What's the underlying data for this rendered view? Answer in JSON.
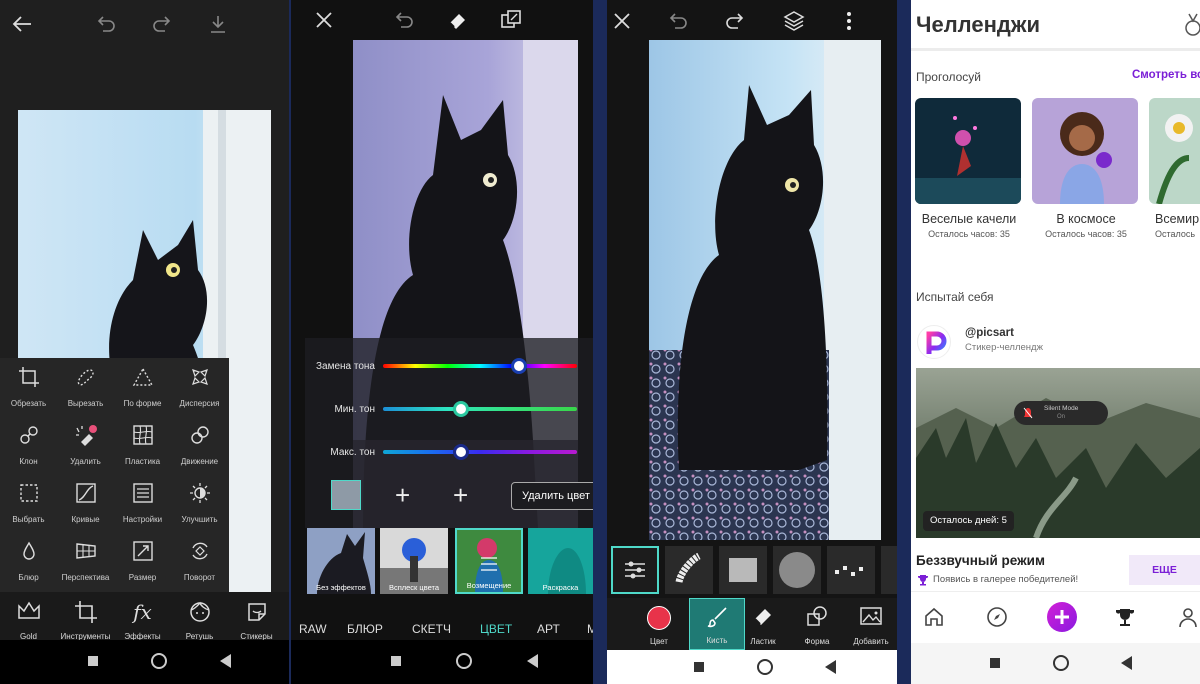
{
  "screen1": {
    "tools": [
      {
        "label": "Обрезать",
        "icon": "crop-icon"
      },
      {
        "label": "Вырезать",
        "icon": "cutout-icon"
      },
      {
        "label": "По форме",
        "icon": "shape-crop-icon"
      },
      {
        "label": "Дисперсия",
        "icon": "dispersion-icon"
      },
      {
        "label": "Клон",
        "icon": "clone-icon"
      },
      {
        "label": "Удалить",
        "icon": "remove-icon"
      },
      {
        "label": "Пластика",
        "icon": "stretch-icon"
      },
      {
        "label": "Движение",
        "icon": "motion-icon"
      },
      {
        "label": "Выбрать",
        "icon": "select-icon"
      },
      {
        "label": "Кривые",
        "icon": "curves-icon"
      },
      {
        "label": "Настройки",
        "icon": "adjust-icon"
      },
      {
        "label": "Улучшить",
        "icon": "enhance-icon"
      },
      {
        "label": "Блюр",
        "icon": "blur-drop-icon"
      },
      {
        "label": "Перспектива",
        "icon": "perspective-icon"
      },
      {
        "label": "Размер",
        "icon": "resize-icon"
      },
      {
        "label": "Поворот",
        "icon": "rotate-icon"
      }
    ],
    "bottom": [
      {
        "label": "Gold",
        "icon": "crown-icon"
      },
      {
        "label": "Инструменты",
        "icon": "crop-icon"
      },
      {
        "label": "Эффекты",
        "icon": "fx-icon",
        "glyph": "fx"
      },
      {
        "label": "Ретушь",
        "icon": "face-icon"
      },
      {
        "label": "Стикеры",
        "icon": "sticker-icon"
      }
    ]
  },
  "screen2": {
    "sliders": [
      {
        "label": "Замена тона",
        "value": 0.7
      },
      {
        "label": "Мин. тон",
        "value": 0.4
      },
      {
        "label": "Макс. тон",
        "value": 0.4
      }
    ],
    "plus1": "+",
    "plus2": "+",
    "remove_color": "Удалить цвет",
    "swatch_color": "#8e9aa6",
    "thumbs": [
      {
        "label": "Без эффектов"
      },
      {
        "label": "Всплеск цвета"
      },
      {
        "label": "Возмещение"
      },
      {
        "label": "Раскраска"
      }
    ],
    "categories": [
      "RAW",
      "БЛЮР",
      "СКЕТЧ",
      "ЦВЕТ",
      "АРТ",
      "M"
    ],
    "active_category": "ЦВЕТ",
    "accent": "#4fd9c9"
  },
  "screen3": {
    "tools": [
      {
        "label": "Цвет",
        "icon": "color-dot-icon"
      },
      {
        "label": "Кисть",
        "icon": "brush-icon"
      },
      {
        "label": "Ластик",
        "icon": "eraser-icon"
      },
      {
        "label": "Форма",
        "icon": "shape-icon"
      },
      {
        "label": "Добавить",
        "icon": "add-photo-icon"
      }
    ],
    "brush_color": "#e8334a"
  },
  "screen4": {
    "title": "Челленджи",
    "vote": "Проголосуй",
    "see_all": "Смотреть все",
    "cards": [
      {
        "title": "Веселые качели",
        "sub": "Осталось часов: 35"
      },
      {
        "title": "В космосе",
        "sub": "Осталось часов: 35"
      },
      {
        "title": "Всемирн",
        "sub": "Осталось"
      }
    ],
    "try_yourself": "Испытай себя",
    "author": "@picsart",
    "author_sub": "Стикер-челлендж",
    "silent_mode": "Silent Mode",
    "silent_on": "On",
    "days_left": "Осталось дней: 5",
    "challenge_title": "Беззвучный режим",
    "challenge_sub": "Появись в галерее победителей!",
    "more": "ЕЩЕ",
    "accent": "#7b1fd6"
  }
}
